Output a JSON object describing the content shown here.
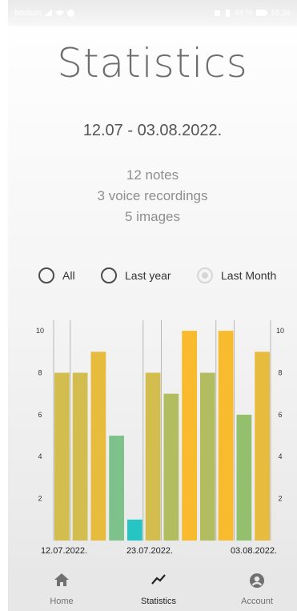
{
  "status_bar": {
    "carrier": "bonbon",
    "battery": "44 %",
    "time": "16:36"
  },
  "page_title": "Statistics",
  "date_range": "12.07 - 03.08.2022.",
  "summary": {
    "notes": "12 notes",
    "voice_recordings": "3 voice recordings",
    "images": "5 images"
  },
  "filters": [
    {
      "label": "All",
      "state": "unselected"
    },
    {
      "label": "Last year",
      "state": "unselected"
    },
    {
      "label": "Last Month",
      "state": "selected-disabled"
    }
  ],
  "chart_data": {
    "type": "bar",
    "values": [
      8,
      8,
      9,
      5,
      1,
      8,
      7,
      10,
      8,
      10,
      6,
      9
    ],
    "bar_colors": [
      "#d4bd4f",
      "#d4bd4f",
      "#e7bb3e",
      "#7cc28a",
      "#26c4c2",
      "#d4bd4f",
      "#b2bd5f",
      "#f8bb2e",
      "#b2bd5f",
      "#f8bb2e",
      "#94c06e",
      "#e7bb3e"
    ],
    "y_ticks": [
      "2",
      "4",
      "6",
      "8",
      "10"
    ],
    "x_labels": [
      "12.07.2022.",
      "23.07.2022.",
      "03.08.2022."
    ],
    "ylim": [
      0,
      10.5
    ],
    "grid": "vertical-lines"
  },
  "bottom_nav": [
    {
      "label": "Home",
      "icon": "home-icon",
      "active": false
    },
    {
      "label": "Statistics",
      "icon": "trend-icon",
      "active": true
    },
    {
      "label": "Account",
      "icon": "account-icon",
      "active": false
    }
  ],
  "colors": {
    "title_gray": "#6d6d6d",
    "nav_active": "#222222",
    "nav_inactive": "#707070"
  }
}
